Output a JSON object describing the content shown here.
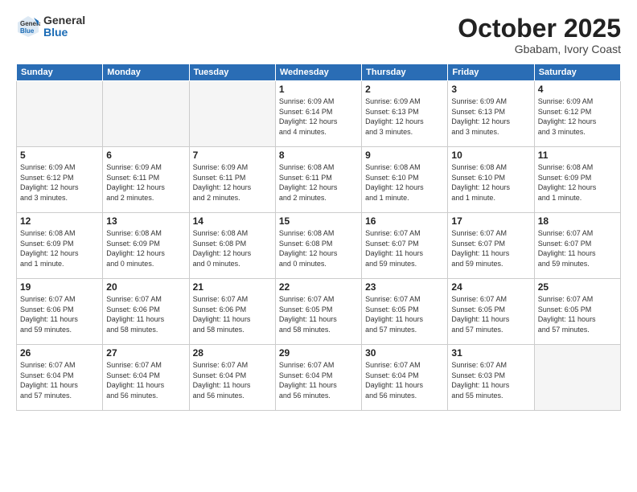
{
  "header": {
    "logo_general": "General",
    "logo_blue": "Blue",
    "month": "October 2025",
    "location": "Gbabam, Ivory Coast"
  },
  "weekdays": [
    "Sunday",
    "Monday",
    "Tuesday",
    "Wednesday",
    "Thursday",
    "Friday",
    "Saturday"
  ],
  "weeks": [
    [
      {
        "day": "",
        "info": ""
      },
      {
        "day": "",
        "info": ""
      },
      {
        "day": "",
        "info": ""
      },
      {
        "day": "1",
        "info": "Sunrise: 6:09 AM\nSunset: 6:14 PM\nDaylight: 12 hours\nand 4 minutes."
      },
      {
        "day": "2",
        "info": "Sunrise: 6:09 AM\nSunset: 6:13 PM\nDaylight: 12 hours\nand 3 minutes."
      },
      {
        "day": "3",
        "info": "Sunrise: 6:09 AM\nSunset: 6:13 PM\nDaylight: 12 hours\nand 3 minutes."
      },
      {
        "day": "4",
        "info": "Sunrise: 6:09 AM\nSunset: 6:12 PM\nDaylight: 12 hours\nand 3 minutes."
      }
    ],
    [
      {
        "day": "5",
        "info": "Sunrise: 6:09 AM\nSunset: 6:12 PM\nDaylight: 12 hours\nand 3 minutes."
      },
      {
        "day": "6",
        "info": "Sunrise: 6:09 AM\nSunset: 6:11 PM\nDaylight: 12 hours\nand 2 minutes."
      },
      {
        "day": "7",
        "info": "Sunrise: 6:09 AM\nSunset: 6:11 PM\nDaylight: 12 hours\nand 2 minutes."
      },
      {
        "day": "8",
        "info": "Sunrise: 6:08 AM\nSunset: 6:11 PM\nDaylight: 12 hours\nand 2 minutes."
      },
      {
        "day": "9",
        "info": "Sunrise: 6:08 AM\nSunset: 6:10 PM\nDaylight: 12 hours\nand 1 minute."
      },
      {
        "day": "10",
        "info": "Sunrise: 6:08 AM\nSunset: 6:10 PM\nDaylight: 12 hours\nand 1 minute."
      },
      {
        "day": "11",
        "info": "Sunrise: 6:08 AM\nSunset: 6:09 PM\nDaylight: 12 hours\nand 1 minute."
      }
    ],
    [
      {
        "day": "12",
        "info": "Sunrise: 6:08 AM\nSunset: 6:09 PM\nDaylight: 12 hours\nand 1 minute."
      },
      {
        "day": "13",
        "info": "Sunrise: 6:08 AM\nSunset: 6:09 PM\nDaylight: 12 hours\nand 0 minutes."
      },
      {
        "day": "14",
        "info": "Sunrise: 6:08 AM\nSunset: 6:08 PM\nDaylight: 12 hours\nand 0 minutes."
      },
      {
        "day": "15",
        "info": "Sunrise: 6:08 AM\nSunset: 6:08 PM\nDaylight: 12 hours\nand 0 minutes."
      },
      {
        "day": "16",
        "info": "Sunrise: 6:07 AM\nSunset: 6:07 PM\nDaylight: 11 hours\nand 59 minutes."
      },
      {
        "day": "17",
        "info": "Sunrise: 6:07 AM\nSunset: 6:07 PM\nDaylight: 11 hours\nand 59 minutes."
      },
      {
        "day": "18",
        "info": "Sunrise: 6:07 AM\nSunset: 6:07 PM\nDaylight: 11 hours\nand 59 minutes."
      }
    ],
    [
      {
        "day": "19",
        "info": "Sunrise: 6:07 AM\nSunset: 6:06 PM\nDaylight: 11 hours\nand 59 minutes."
      },
      {
        "day": "20",
        "info": "Sunrise: 6:07 AM\nSunset: 6:06 PM\nDaylight: 11 hours\nand 58 minutes."
      },
      {
        "day": "21",
        "info": "Sunrise: 6:07 AM\nSunset: 6:06 PM\nDaylight: 11 hours\nand 58 minutes."
      },
      {
        "day": "22",
        "info": "Sunrise: 6:07 AM\nSunset: 6:05 PM\nDaylight: 11 hours\nand 58 minutes."
      },
      {
        "day": "23",
        "info": "Sunrise: 6:07 AM\nSunset: 6:05 PM\nDaylight: 11 hours\nand 57 minutes."
      },
      {
        "day": "24",
        "info": "Sunrise: 6:07 AM\nSunset: 6:05 PM\nDaylight: 11 hours\nand 57 minutes."
      },
      {
        "day": "25",
        "info": "Sunrise: 6:07 AM\nSunset: 6:05 PM\nDaylight: 11 hours\nand 57 minutes."
      }
    ],
    [
      {
        "day": "26",
        "info": "Sunrise: 6:07 AM\nSunset: 6:04 PM\nDaylight: 11 hours\nand 57 minutes."
      },
      {
        "day": "27",
        "info": "Sunrise: 6:07 AM\nSunset: 6:04 PM\nDaylight: 11 hours\nand 56 minutes."
      },
      {
        "day": "28",
        "info": "Sunrise: 6:07 AM\nSunset: 6:04 PM\nDaylight: 11 hours\nand 56 minutes."
      },
      {
        "day": "29",
        "info": "Sunrise: 6:07 AM\nSunset: 6:04 PM\nDaylight: 11 hours\nand 56 minutes."
      },
      {
        "day": "30",
        "info": "Sunrise: 6:07 AM\nSunset: 6:04 PM\nDaylight: 11 hours\nand 56 minutes."
      },
      {
        "day": "31",
        "info": "Sunrise: 6:07 AM\nSunset: 6:03 PM\nDaylight: 11 hours\nand 55 minutes."
      },
      {
        "day": "",
        "info": ""
      }
    ]
  ]
}
